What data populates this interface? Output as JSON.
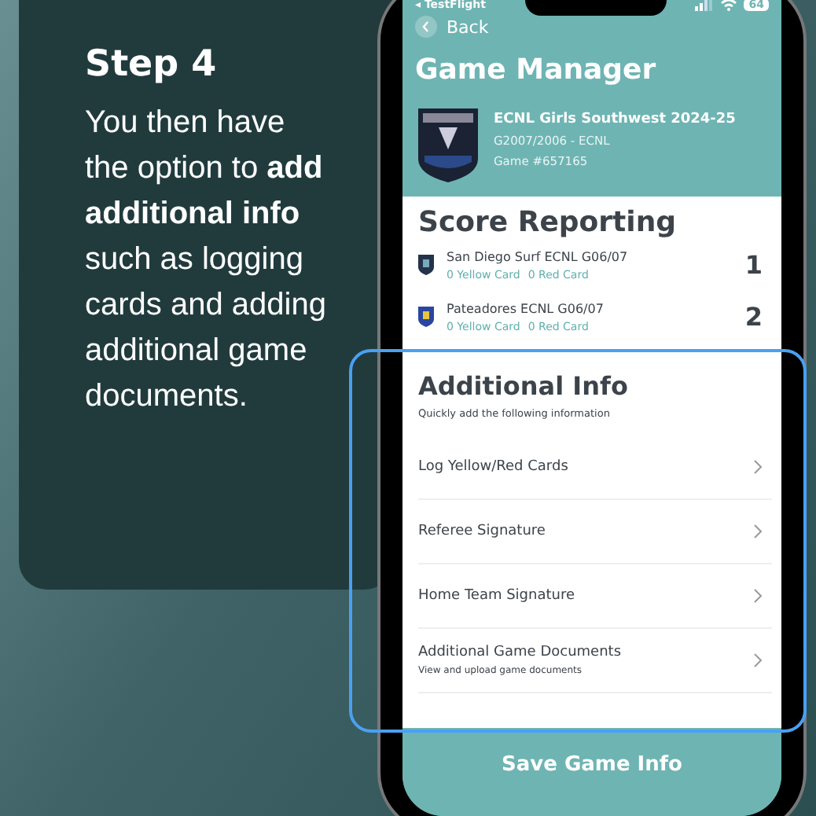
{
  "step_card": {
    "title": "Step 4",
    "body": "You then have the option to **add additional info** such as logging cards and adding additional game documents."
  },
  "phone": {
    "status_bar": {
      "carrier": "◂ TestFlight",
      "battery": "64"
    },
    "back": "Back",
    "title": "Game Manager",
    "league": {
      "name": "ECNL Girls Southwest 2024-25",
      "division": "G2007/2006 - ECNL",
      "game": "Game #657165"
    },
    "score_reporting": {
      "title": "Score Reporting",
      "teams": [
        {
          "name": "San Diego Surf ECNL G06/07",
          "yellow": "0 Yellow Card",
          "red": "0 Red Card",
          "score": "1"
        },
        {
          "name": "Pateadores ECNL G06/07",
          "yellow": "0 Yellow Card",
          "red": "0 Red Card",
          "score": "2"
        }
      ]
    },
    "additional_info": {
      "title": "Additional Info",
      "subtitle": "Quickly add the following information",
      "items": [
        {
          "label": "Log Yellow/Red Cards"
        },
        {
          "label": "Referee Signature"
        },
        {
          "label": "Home Team Signature"
        },
        {
          "label": "Additional Game Documents",
          "sublabel": "View and upload game documents"
        }
      ]
    },
    "save_button": "Save Game Info"
  }
}
